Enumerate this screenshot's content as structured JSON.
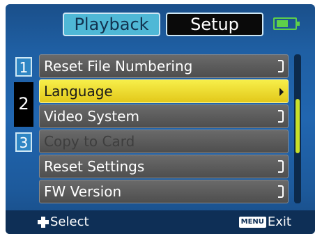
{
  "tabs": [
    {
      "label": "Playback",
      "active": false
    },
    {
      "label": "Setup",
      "active": true
    }
  ],
  "battery": {
    "level": 0.6,
    "color": "#5fd04a"
  },
  "pages": [
    "1",
    "2",
    "3"
  ],
  "current_page": "2",
  "menu": {
    "items": [
      {
        "label": "Reset File Numbering",
        "state": "normal"
      },
      {
        "label": "Language",
        "state": "selected"
      },
      {
        "label": "Video System",
        "state": "normal"
      },
      {
        "label": "Copy to Card",
        "state": "disabled"
      },
      {
        "label": "Reset Settings",
        "state": "normal"
      },
      {
        "label": "FW Version",
        "state": "normal"
      }
    ]
  },
  "footer": {
    "select_key": "dpad",
    "select_label": "Select",
    "exit_key": "MENU",
    "exit_label": "Exit"
  },
  "colors": {
    "highlight": "#f2e23a",
    "background": "#1f5fa3",
    "active_tab": "#0a0a0a",
    "inactive_tab": "#4fb8d6"
  }
}
